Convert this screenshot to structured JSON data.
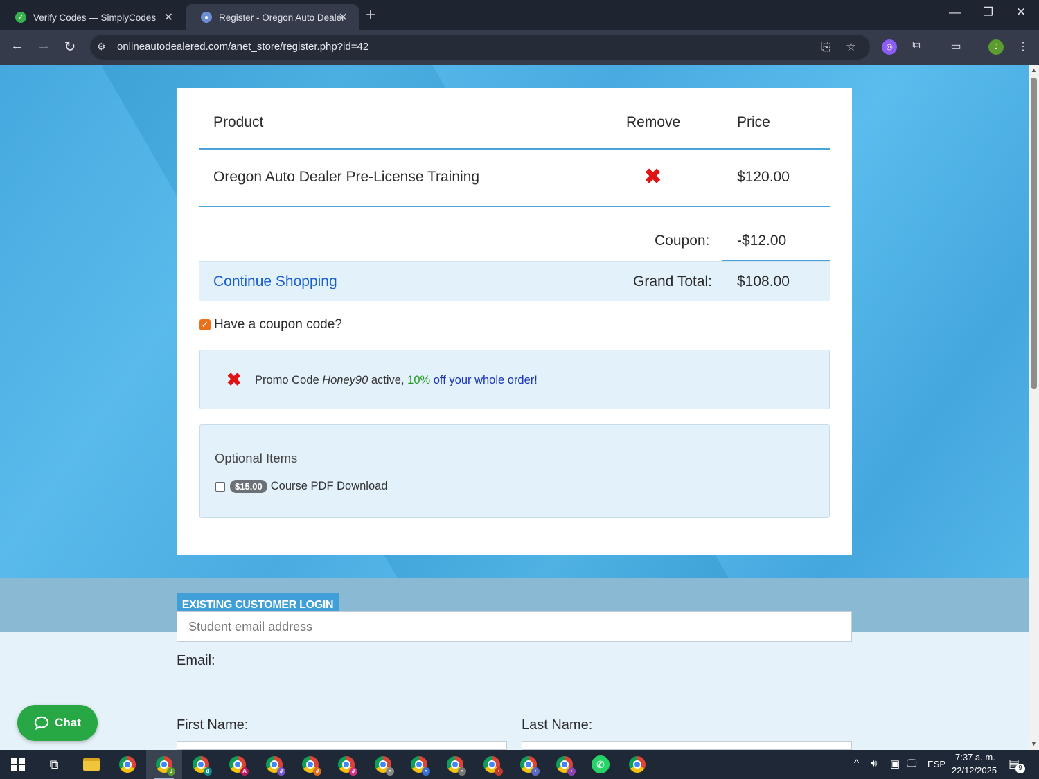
{
  "browser": {
    "tabs": [
      {
        "title": "Verify Codes — SimplyCodes"
      },
      {
        "title": "Register - Oregon Auto Dealer Pre-License"
      }
    ],
    "url": "onlineautodealered.com/anet_store/register.php?id=42",
    "profile_initial": "J"
  },
  "cart": {
    "headers": {
      "product": "Product",
      "remove": "Remove",
      "price": "Price"
    },
    "item": {
      "name": "Oregon Auto Dealer Pre-License Training",
      "remove_symbol": "✖",
      "price": "$120.00"
    },
    "coupon": {
      "label": "Coupon:",
      "value": "-$12.00"
    },
    "continue_shopping": "Continue Shopping",
    "grand_total": {
      "label": "Grand Total:",
      "value": "$108.00"
    }
  },
  "coupon_toggle": {
    "label": "Have a coupon code?",
    "checked": true
  },
  "promo": {
    "remove_symbol": "✖",
    "prefix": "Promo Code ",
    "code": "Honey90",
    "middle": " active, ",
    "percent": "10%",
    "suffix": " off your whole order!"
  },
  "optional_items": {
    "title": "Optional Items",
    "items": [
      {
        "price_badge": "$15.00",
        "label": "Course PDF Download",
        "checked": false
      }
    ]
  },
  "login": {
    "button_label": "EXISTING CUSTOMER LOGIN"
  },
  "form": {
    "email_label": "Email:",
    "email_placeholder": "Student email address",
    "first_name_label": "First Name:",
    "last_name_label": "Last Name:"
  },
  "chat": {
    "label": "Chat"
  },
  "taskbar": {
    "language": "ESP",
    "time": "7:37 a. m.",
    "date": "22/12/2025",
    "notification_count": "9"
  },
  "colors": {
    "accent": "#4aa3d6",
    "remove_red": "#e01414",
    "link_blue": "#1a5fd1",
    "chat_green": "#27a844"
  }
}
